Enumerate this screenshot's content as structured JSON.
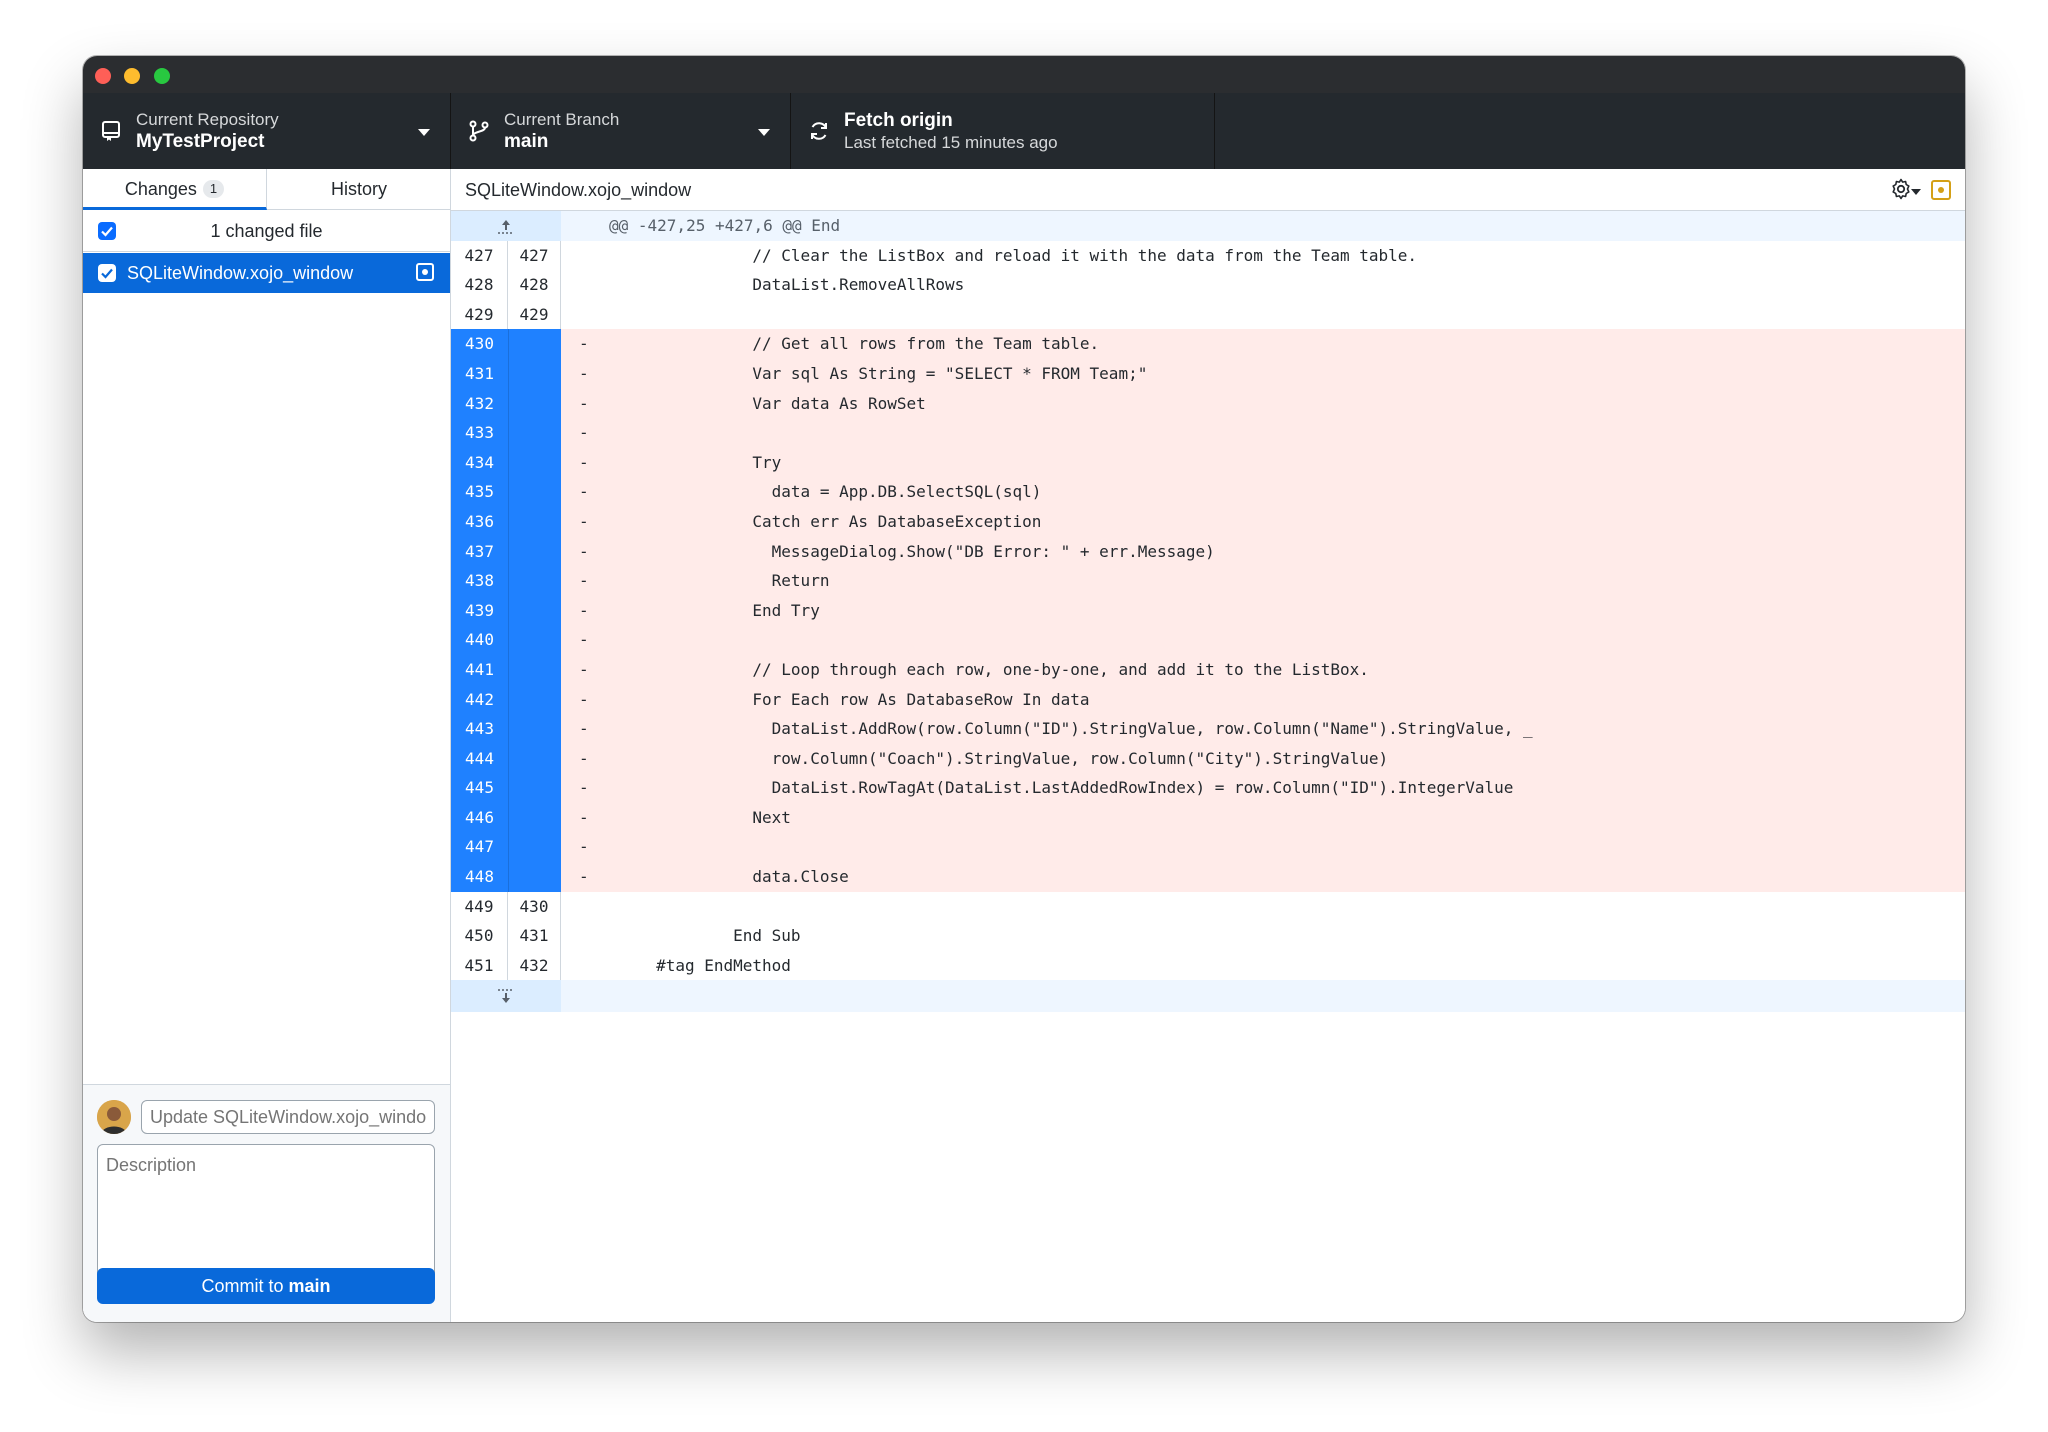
{
  "toolbar": {
    "repo_label": "Current Repository",
    "repo_name": "MyTestProject",
    "branch_label": "Current Branch",
    "branch_name": "main",
    "fetch_title": "Fetch origin",
    "fetch_status": "Last fetched 15 minutes ago"
  },
  "sidebar": {
    "tabs": [
      {
        "label": "Changes",
        "badge": "1"
      },
      {
        "label": "History"
      }
    ],
    "changed_files_title": "1 changed file",
    "files": [
      {
        "name": "SQLiteWindow.xojo_window",
        "checked": true
      }
    ],
    "commit": {
      "summary_placeholder": "Update SQLiteWindow.xojo_window",
      "description_placeholder": "Description",
      "button_prefix": "Commit to ",
      "button_branch": "main"
    }
  },
  "diff": {
    "filename": "SQLiteWindow.xojo_window",
    "hunk_header": "@@ -427,25 +427,6 @@ End",
    "lines": [
      {
        "type": "ctx",
        "old": "427",
        "new": "427",
        "text": "                  // Clear the ListBox and reload it with the data from the Team table."
      },
      {
        "type": "ctx",
        "old": "428",
        "new": "428",
        "text": "                  DataList.RemoveAllRows"
      },
      {
        "type": "ctx",
        "old": "429",
        "new": "429",
        "text": ""
      },
      {
        "type": "del",
        "old": "430",
        "new": "",
        "text": "-                 // Get all rows from the Team table."
      },
      {
        "type": "del",
        "old": "431",
        "new": "",
        "text": "-                 Var sql As String = \"SELECT * FROM Team;\""
      },
      {
        "type": "del",
        "old": "432",
        "new": "",
        "text": "-                 Var data As RowSet"
      },
      {
        "type": "del",
        "old": "433",
        "new": "",
        "text": "-"
      },
      {
        "type": "del",
        "old": "434",
        "new": "",
        "text": "-                 Try"
      },
      {
        "type": "del",
        "old": "435",
        "new": "",
        "text": "-                   data = App.DB.SelectSQL(sql)"
      },
      {
        "type": "del",
        "old": "436",
        "new": "",
        "text": "-                 Catch err As DatabaseException"
      },
      {
        "type": "del",
        "old": "437",
        "new": "",
        "text": "-                   MessageDialog.Show(\"DB Error: \" + err.Message)"
      },
      {
        "type": "del",
        "old": "438",
        "new": "",
        "text": "-                   Return"
      },
      {
        "type": "del",
        "old": "439",
        "new": "",
        "text": "-                 End Try"
      },
      {
        "type": "del",
        "old": "440",
        "new": "",
        "text": "-"
      },
      {
        "type": "del",
        "old": "441",
        "new": "",
        "text": "-                 // Loop through each row, one-by-one, and add it to the ListBox."
      },
      {
        "type": "del",
        "old": "442",
        "new": "",
        "text": "-                 For Each row As DatabaseRow In data"
      },
      {
        "type": "del",
        "old": "443",
        "new": "",
        "text": "-                   DataList.AddRow(row.Column(\"ID\").StringValue, row.Column(\"Name\").StringValue, _"
      },
      {
        "type": "del",
        "old": "444",
        "new": "",
        "text": "-                   row.Column(\"Coach\").StringValue, row.Column(\"City\").StringValue)"
      },
      {
        "type": "del",
        "old": "445",
        "new": "",
        "text": "-                   DataList.RowTagAt(DataList.LastAddedRowIndex) = row.Column(\"ID\").IntegerValue"
      },
      {
        "type": "del",
        "old": "446",
        "new": "",
        "text": "-                 Next"
      },
      {
        "type": "del",
        "old": "447",
        "new": "",
        "text": "-"
      },
      {
        "type": "del",
        "old": "448",
        "new": "",
        "text": "-                 data.Close"
      },
      {
        "type": "ctx",
        "old": "449",
        "new": "430",
        "text": ""
      },
      {
        "type": "ctx",
        "old": "450",
        "new": "431",
        "text": "                End Sub"
      },
      {
        "type": "ctx",
        "old": "451",
        "new": "432",
        "text": "        #tag EndMethod"
      }
    ]
  },
  "colors": {
    "accent": "#0969da",
    "deletion_bg": "#ffebe9",
    "deletion_gutter": "#1f81ff",
    "toolbar_bg": "#24292e"
  }
}
